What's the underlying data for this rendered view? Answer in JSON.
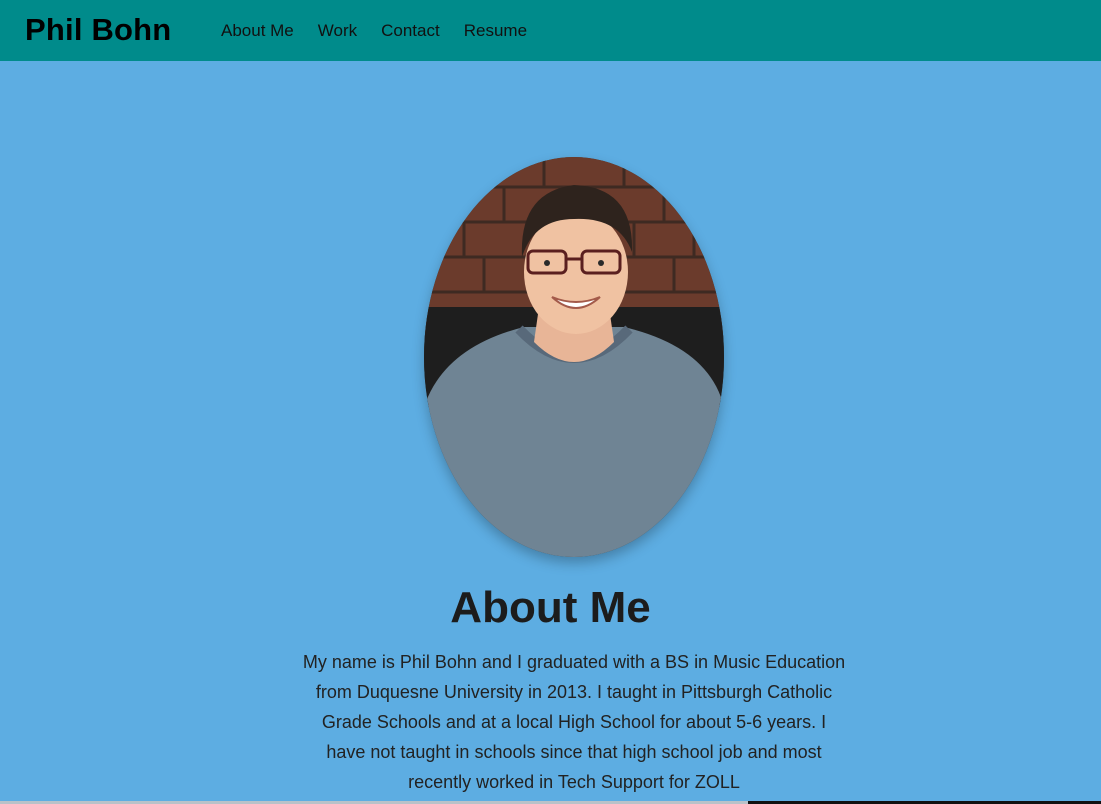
{
  "navbar": {
    "brand": "Phil Bohn",
    "links": [
      "About Me",
      "Work",
      "Contact",
      "Resume"
    ],
    "background": "#008b8b"
  },
  "page": {
    "background": "#5dade2"
  },
  "about": {
    "portrait_alt": "portrait photo",
    "heading": "About Me",
    "bio": "My name is Phil Bohn and I graduated with a BS in Music Education from Duquesne University in 2013. I taught in Pittsburgh Catholic Grade Schools and at a local High School for about 5-6 years. I have not taught in schools since that high school job and most recently worked in Tech Support for ZOLL"
  }
}
